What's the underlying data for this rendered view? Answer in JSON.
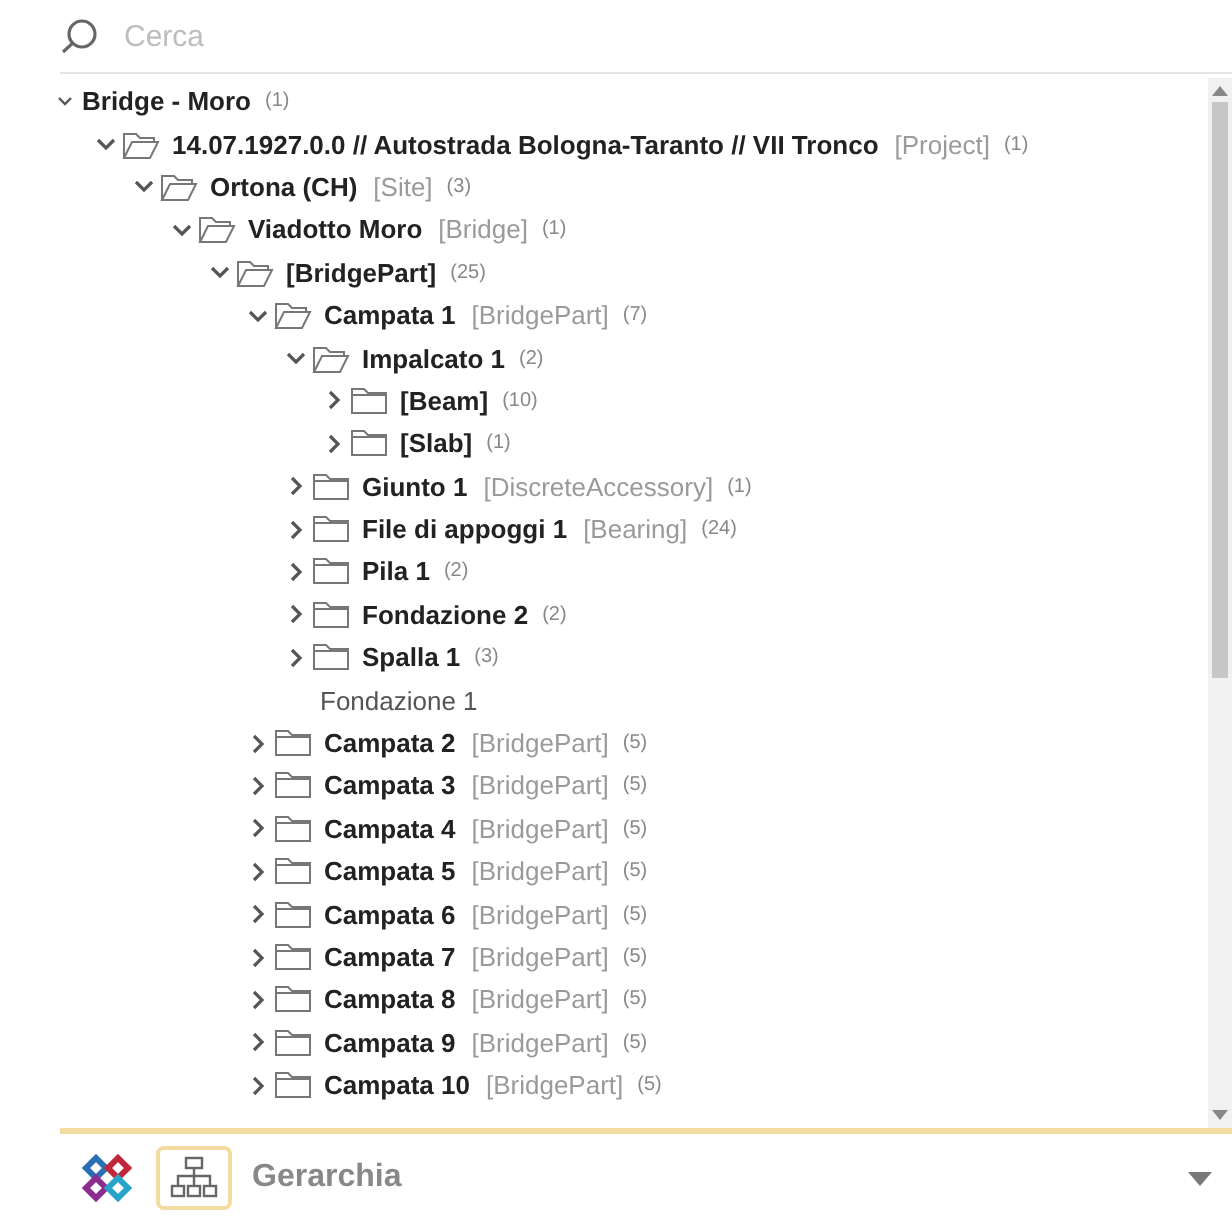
{
  "search": {
    "placeholder": "Cerca"
  },
  "tree": [
    {
      "kind": "root",
      "label": "Bridge - Moro",
      "count": "(1)",
      "expanded": true,
      "children": [
        {
          "kind": "folder",
          "label": "14.07.1927.0.0 // Autostrada Bologna-Taranto // VII Tronco",
          "type": "[Project]",
          "count": "(1)",
          "expanded": true,
          "children": [
            {
              "kind": "folder",
              "label": "Ortona (CH)",
              "type": "[Site]",
              "count": "(3)",
              "expanded": true,
              "children": [
                {
                  "kind": "folder",
                  "label": "Viadotto Moro",
                  "type": "[Bridge]",
                  "count": "(1)",
                  "expanded": true,
                  "children": [
                    {
                      "kind": "folder",
                      "label": "[BridgePart]",
                      "count": "(25)",
                      "expanded": true,
                      "children": [
                        {
                          "kind": "folder",
                          "label": "Campata 1",
                          "type": "[BridgePart]",
                          "count": "(7)",
                          "expanded": true,
                          "children": [
                            {
                              "kind": "folder",
                              "label": "Impalcato 1",
                              "count": "(2)",
                              "expanded": true,
                              "children": [
                                {
                                  "kind": "folder",
                                  "label": "[Beam]",
                                  "count": "(10)",
                                  "expanded": false
                                },
                                {
                                  "kind": "folder",
                                  "label": "[Slab]",
                                  "count": "(1)",
                                  "expanded": false
                                }
                              ]
                            },
                            {
                              "kind": "folder",
                              "label": "Giunto 1",
                              "type": "[DiscreteAccessory]",
                              "count": "(1)",
                              "expanded": false
                            },
                            {
                              "kind": "folder",
                              "label": "File di appoggi 1",
                              "type": "[Bearing]",
                              "count": "(24)",
                              "expanded": false
                            },
                            {
                              "kind": "folder",
                              "label": "Pila 1",
                              "count": "(2)",
                              "expanded": false
                            },
                            {
                              "kind": "folder",
                              "label": "Fondazione 2",
                              "count": "(2)",
                              "expanded": false
                            },
                            {
                              "kind": "folder",
                              "label": "Spalla 1",
                              "count": "(3)",
                              "expanded": false
                            },
                            {
                              "kind": "leaf",
                              "label": "Fondazione 1"
                            }
                          ]
                        },
                        {
                          "kind": "folder",
                          "label": "Campata 2",
                          "type": "[BridgePart]",
                          "count": "(5)",
                          "expanded": false
                        },
                        {
                          "kind": "folder",
                          "label": "Campata 3",
                          "type": "[BridgePart]",
                          "count": "(5)",
                          "expanded": false
                        },
                        {
                          "kind": "folder",
                          "label": "Campata 4",
                          "type": "[BridgePart]",
                          "count": "(5)",
                          "expanded": false
                        },
                        {
                          "kind": "folder",
                          "label": "Campata 5",
                          "type": "[BridgePart]",
                          "count": "(5)",
                          "expanded": false
                        },
                        {
                          "kind": "folder",
                          "label": "Campata 6",
                          "type": "[BridgePart]",
                          "count": "(5)",
                          "expanded": false
                        },
                        {
                          "kind": "folder",
                          "label": "Campata 7",
                          "type": "[BridgePart]",
                          "count": "(5)",
                          "expanded": false
                        },
                        {
                          "kind": "folder",
                          "label": "Campata 8",
                          "type": "[BridgePart]",
                          "count": "(5)",
                          "expanded": false
                        },
                        {
                          "kind": "folder",
                          "label": "Campata 9",
                          "type": "[BridgePart]",
                          "count": "(5)",
                          "expanded": false
                        },
                        {
                          "kind": "folder",
                          "label": "Campata 10",
                          "type": "[BridgePart]",
                          "count": "(5)",
                          "expanded": false
                        }
                      ]
                    }
                  ]
                }
              ]
            }
          ]
        }
      ]
    }
  ],
  "footer": {
    "view": "Gerarchia"
  }
}
